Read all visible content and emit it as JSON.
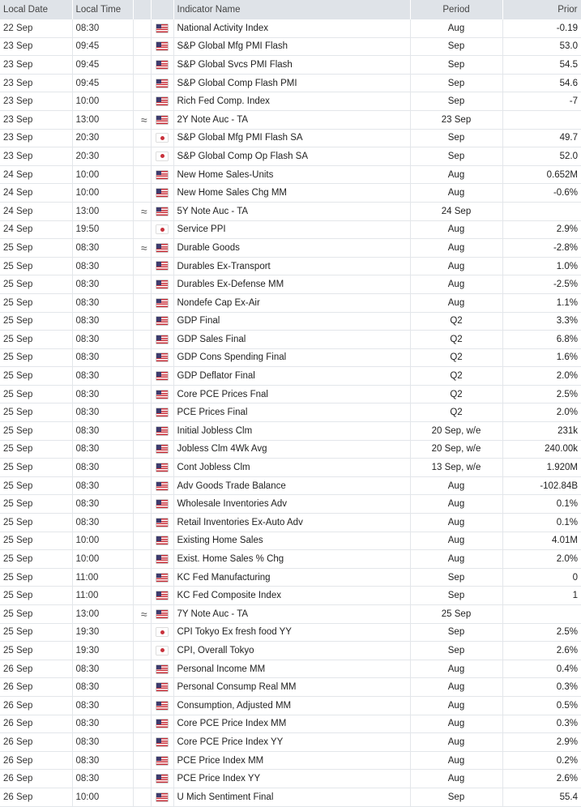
{
  "headers": {
    "date": "Local Date",
    "time": "Local Time",
    "name": "Indicator Name",
    "period": "Period",
    "prior": "Prior"
  },
  "rows": [
    {
      "date": "22 Sep",
      "time": "08:30",
      "vol": "",
      "flag": "us",
      "name": "National Activity Index",
      "period": "Aug",
      "prior": "-0.19"
    },
    {
      "date": "23 Sep",
      "time": "09:45",
      "vol": "",
      "flag": "us",
      "name": "S&P Global Mfg PMI Flash",
      "period": "Sep",
      "prior": "53.0"
    },
    {
      "date": "23 Sep",
      "time": "09:45",
      "vol": "",
      "flag": "us",
      "name": "S&P Global Svcs PMI Flash",
      "period": "Sep",
      "prior": "54.5"
    },
    {
      "date": "23 Sep",
      "time": "09:45",
      "vol": "",
      "flag": "us",
      "name": "S&P Global Comp Flash PMI",
      "period": "Sep",
      "prior": "54.6"
    },
    {
      "date": "23 Sep",
      "time": "10:00",
      "vol": "",
      "flag": "us",
      "name": "Rich Fed Comp. Index",
      "period": "Sep",
      "prior": "-7"
    },
    {
      "date": "23 Sep",
      "time": "13:00",
      "vol": "≈",
      "flag": "us",
      "name": "2Y Note Auc - TA",
      "period": "23 Sep",
      "prior": ""
    },
    {
      "date": "23 Sep",
      "time": "20:30",
      "vol": "",
      "flag": "jp",
      "name": "S&P Global Mfg PMI Flash SA",
      "period": "Sep",
      "prior": "49.7"
    },
    {
      "date": "23 Sep",
      "time": "20:30",
      "vol": "",
      "flag": "jp",
      "name": "S&P Global Comp Op Flash SA",
      "period": "Sep",
      "prior": "52.0"
    },
    {
      "date": "24 Sep",
      "time": "10:00",
      "vol": "",
      "flag": "us",
      "name": "New Home Sales-Units",
      "period": "Aug",
      "prior": "0.652M"
    },
    {
      "date": "24 Sep",
      "time": "10:00",
      "vol": "",
      "flag": "us",
      "name": "New Home Sales Chg MM",
      "period": "Aug",
      "prior": "-0.6%"
    },
    {
      "date": "24 Sep",
      "time": "13:00",
      "vol": "≈",
      "flag": "us",
      "name": "5Y Note Auc - TA",
      "period": "24 Sep",
      "prior": ""
    },
    {
      "date": "24 Sep",
      "time": "19:50",
      "vol": "",
      "flag": "jp",
      "name": "Service PPI",
      "period": "Aug",
      "prior": "2.9%"
    },
    {
      "date": "25 Sep",
      "time": "08:30",
      "vol": "≈",
      "flag": "us",
      "name": "Durable Goods",
      "period": "Aug",
      "prior": "-2.8%"
    },
    {
      "date": "25 Sep",
      "time": "08:30",
      "vol": "",
      "flag": "us",
      "name": "Durables Ex-Transport",
      "period": "Aug",
      "prior": "1.0%"
    },
    {
      "date": "25 Sep",
      "time": "08:30",
      "vol": "",
      "flag": "us",
      "name": "Durables Ex-Defense MM",
      "period": "Aug",
      "prior": "-2.5%"
    },
    {
      "date": "25 Sep",
      "time": "08:30",
      "vol": "",
      "flag": "us",
      "name": "Nondefe Cap Ex-Air",
      "period": "Aug",
      "prior": "1.1%"
    },
    {
      "date": "25 Sep",
      "time": "08:30",
      "vol": "",
      "flag": "us",
      "name": "GDP Final",
      "period": "Q2",
      "prior": "3.3%"
    },
    {
      "date": "25 Sep",
      "time": "08:30",
      "vol": "",
      "flag": "us",
      "name": "GDP Sales Final",
      "period": "Q2",
      "prior": "6.8%"
    },
    {
      "date": "25 Sep",
      "time": "08:30",
      "vol": "",
      "flag": "us",
      "name": "GDP Cons Spending Final",
      "period": "Q2",
      "prior": "1.6%"
    },
    {
      "date": "25 Sep",
      "time": "08:30",
      "vol": "",
      "flag": "us",
      "name": "GDP Deflator Final",
      "period": "Q2",
      "prior": "2.0%"
    },
    {
      "date": "25 Sep",
      "time": "08:30",
      "vol": "",
      "flag": "us",
      "name": "Core PCE Prices Fnal",
      "period": "Q2",
      "prior": "2.5%"
    },
    {
      "date": "25 Sep",
      "time": "08:30",
      "vol": "",
      "flag": "us",
      "name": "PCE Prices Final",
      "period": "Q2",
      "prior": "2.0%"
    },
    {
      "date": "25 Sep",
      "time": "08:30",
      "vol": "",
      "flag": "us",
      "name": "Initial Jobless Clm",
      "period": "20 Sep, w/e",
      "prior": "231k"
    },
    {
      "date": "25 Sep",
      "time": "08:30",
      "vol": "",
      "flag": "us",
      "name": "Jobless Clm 4Wk Avg",
      "period": "20 Sep, w/e",
      "prior": "240.00k"
    },
    {
      "date": "25 Sep",
      "time": "08:30",
      "vol": "",
      "flag": "us",
      "name": "Cont Jobless Clm",
      "period": "13 Sep, w/e",
      "prior": "1.920M"
    },
    {
      "date": "25 Sep",
      "time": "08:30",
      "vol": "",
      "flag": "us",
      "name": "Adv Goods Trade Balance",
      "period": "Aug",
      "prior": "-102.84B"
    },
    {
      "date": "25 Sep",
      "time": "08:30",
      "vol": "",
      "flag": "us",
      "name": "Wholesale Inventories Adv",
      "period": "Aug",
      "prior": "0.1%"
    },
    {
      "date": "25 Sep",
      "time": "08:30",
      "vol": "",
      "flag": "us",
      "name": "Retail Inventories Ex-Auto Adv",
      "period": "Aug",
      "prior": "0.1%"
    },
    {
      "date": "25 Sep",
      "time": "10:00",
      "vol": "",
      "flag": "us",
      "name": "Existing Home Sales",
      "period": "Aug",
      "prior": "4.01M"
    },
    {
      "date": "25 Sep",
      "time": "10:00",
      "vol": "",
      "flag": "us",
      "name": "Exist. Home Sales % Chg",
      "period": "Aug",
      "prior": "2.0%"
    },
    {
      "date": "25 Sep",
      "time": "11:00",
      "vol": "",
      "flag": "us",
      "name": "KC Fed Manufacturing",
      "period": "Sep",
      "prior": "0"
    },
    {
      "date": "25 Sep",
      "time": "11:00",
      "vol": "",
      "flag": "us",
      "name": "KC Fed Composite Index",
      "period": "Sep",
      "prior": "1"
    },
    {
      "date": "25 Sep",
      "time": "13:00",
      "vol": "≈",
      "flag": "us",
      "name": "7Y Note Auc - TA",
      "period": "25 Sep",
      "prior": ""
    },
    {
      "date": "25 Sep",
      "time": "19:30",
      "vol": "",
      "flag": "jp",
      "name": "CPI Tokyo Ex fresh food YY",
      "period": "Sep",
      "prior": "2.5%"
    },
    {
      "date": "25 Sep",
      "time": "19:30",
      "vol": "",
      "flag": "jp",
      "name": "CPI, Overall Tokyo",
      "period": "Sep",
      "prior": "2.6%"
    },
    {
      "date": "26 Sep",
      "time": "08:30",
      "vol": "",
      "flag": "us",
      "name": "Personal Income MM",
      "period": "Aug",
      "prior": "0.4%"
    },
    {
      "date": "26 Sep",
      "time": "08:30",
      "vol": "",
      "flag": "us",
      "name": "Personal Consump Real MM",
      "period": "Aug",
      "prior": "0.3%"
    },
    {
      "date": "26 Sep",
      "time": "08:30",
      "vol": "",
      "flag": "us",
      "name": "Consumption, Adjusted MM",
      "period": "Aug",
      "prior": "0.5%"
    },
    {
      "date": "26 Sep",
      "time": "08:30",
      "vol": "",
      "flag": "us",
      "name": "Core PCE Price Index MM",
      "period": "Aug",
      "prior": "0.3%"
    },
    {
      "date": "26 Sep",
      "time": "08:30",
      "vol": "",
      "flag": "us",
      "name": "Core PCE Price Index YY",
      "period": "Aug",
      "prior": "2.9%"
    },
    {
      "date": "26 Sep",
      "time": "08:30",
      "vol": "",
      "flag": "us",
      "name": "PCE Price Index MM",
      "period": "Aug",
      "prior": "0.2%"
    },
    {
      "date": "26 Sep",
      "time": "08:30",
      "vol": "",
      "flag": "us",
      "name": "PCE Price Index YY",
      "period": "Aug",
      "prior": "2.6%"
    },
    {
      "date": "26 Sep",
      "time": "10:00",
      "vol": "",
      "flag": "us",
      "name": "U Mich Sentiment Final",
      "period": "Sep",
      "prior": "55.4"
    }
  ]
}
